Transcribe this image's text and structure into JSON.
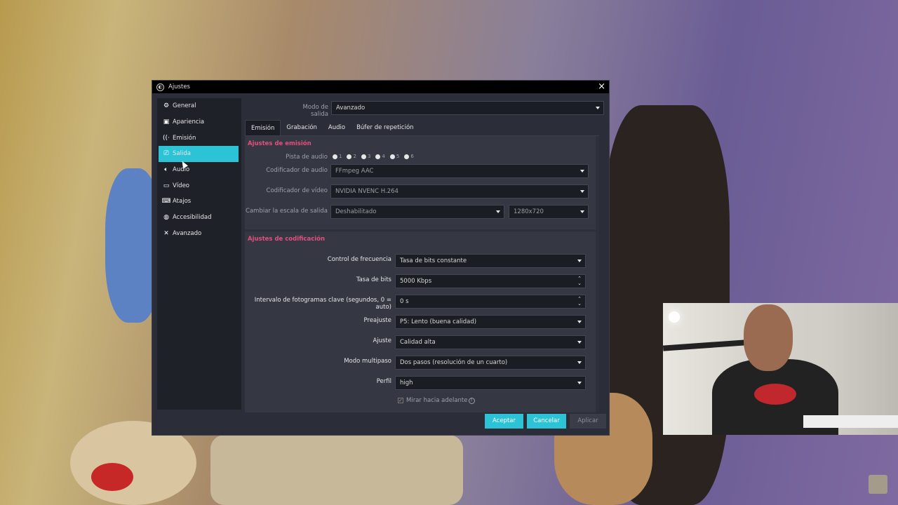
{
  "window": {
    "title": "Ajustes",
    "close_glyph": "×"
  },
  "sidebar": {
    "items": [
      {
        "label": "General",
        "icon": "gear-icon"
      },
      {
        "label": "Apariencia",
        "icon": "appearance-icon"
      },
      {
        "label": "Emisión",
        "icon": "broadcast-icon"
      },
      {
        "label": "Salida",
        "icon": "output-icon"
      },
      {
        "label": "Audio",
        "icon": "speaker-icon"
      },
      {
        "label": "Vídeo",
        "icon": "monitor-icon"
      },
      {
        "label": "Atajos",
        "icon": "keyboard-icon"
      },
      {
        "label": "Accesibilidad",
        "icon": "accessibility-icon"
      },
      {
        "label": "Avanzado",
        "icon": "tools-icon"
      }
    ],
    "active": "Salida"
  },
  "output_mode": {
    "label": "Modo de salida",
    "value": "Avanzado"
  },
  "tabs": [
    "Emisión",
    "Grabación",
    "Audio",
    "Búfer de repetición"
  ],
  "stream": {
    "title": "Ajustes de emisión",
    "audio_track_label": "Pista de audio",
    "tracks": [
      "1",
      "2",
      "3",
      "4",
      "5",
      "6"
    ],
    "audio_encoder": {
      "label": "Codificador de audio",
      "value": "FFmpeg AAC"
    },
    "video_encoder": {
      "label": "Codificador de vídeo",
      "value": "NVIDIA NVENC H.264"
    },
    "rescale": {
      "label": "Cambiar la escala de salida",
      "value": "Deshabilitado",
      "resolution": "1280x720"
    }
  },
  "encoder": {
    "title": "Ajustes de codificación",
    "rate_control": {
      "label": "Control de frecuencia",
      "value": "Tasa de bits constante"
    },
    "bitrate": {
      "label": "Tasa de bits",
      "value": "5000 Kbps"
    },
    "keyframe": {
      "label": "Intervalo de fotogramas clave (segundos, 0 = auto)",
      "value": "0 s"
    },
    "preset": {
      "label": "Preajuste",
      "value": "P5: Lento (buena calidad)"
    },
    "tuning": {
      "label": "Ajuste",
      "value": "Calidad alta"
    },
    "multipass": {
      "label": "Modo multipaso",
      "value": "Dos pasos (resolución de un cuarto)"
    },
    "profile": {
      "label": "Perfil",
      "value": "high"
    },
    "lookahead": {
      "label": "Mirar hacia adelante",
      "help": "?"
    }
  },
  "buttons": {
    "ok": "Aceptar",
    "cancel": "Cancelar",
    "apply": "Aplicar"
  },
  "colors": {
    "accent": "#2cc3d6",
    "group_title": "#e24f7f"
  }
}
